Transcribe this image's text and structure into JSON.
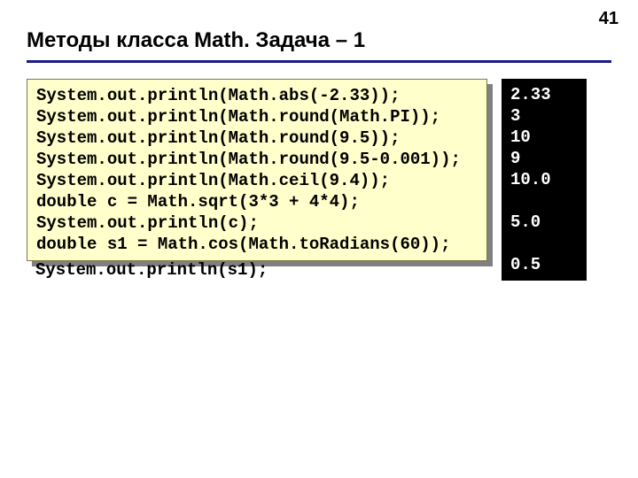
{
  "page_number": "41",
  "title": "Методы класса Math. Задача – 1",
  "code_box": "System.out.println(Math.abs(-2.33));\nSystem.out.println(Math.round(Math.PI));\nSystem.out.println(Math.round(9.5));\nSystem.out.println(Math.round(9.5-0.001));\nSystem.out.println(Math.ceil(9.4));\ndouble c = Math.sqrt(3*3 + 4*4);\nSystem.out.println(c);\ndouble s1 = Math.cos(Math.toRadians(60));",
  "code_overflow": "System.out.println(s1);",
  "output": "2.33\n3\n10\n9\n10.0\n\n5.0\n\n0.5"
}
